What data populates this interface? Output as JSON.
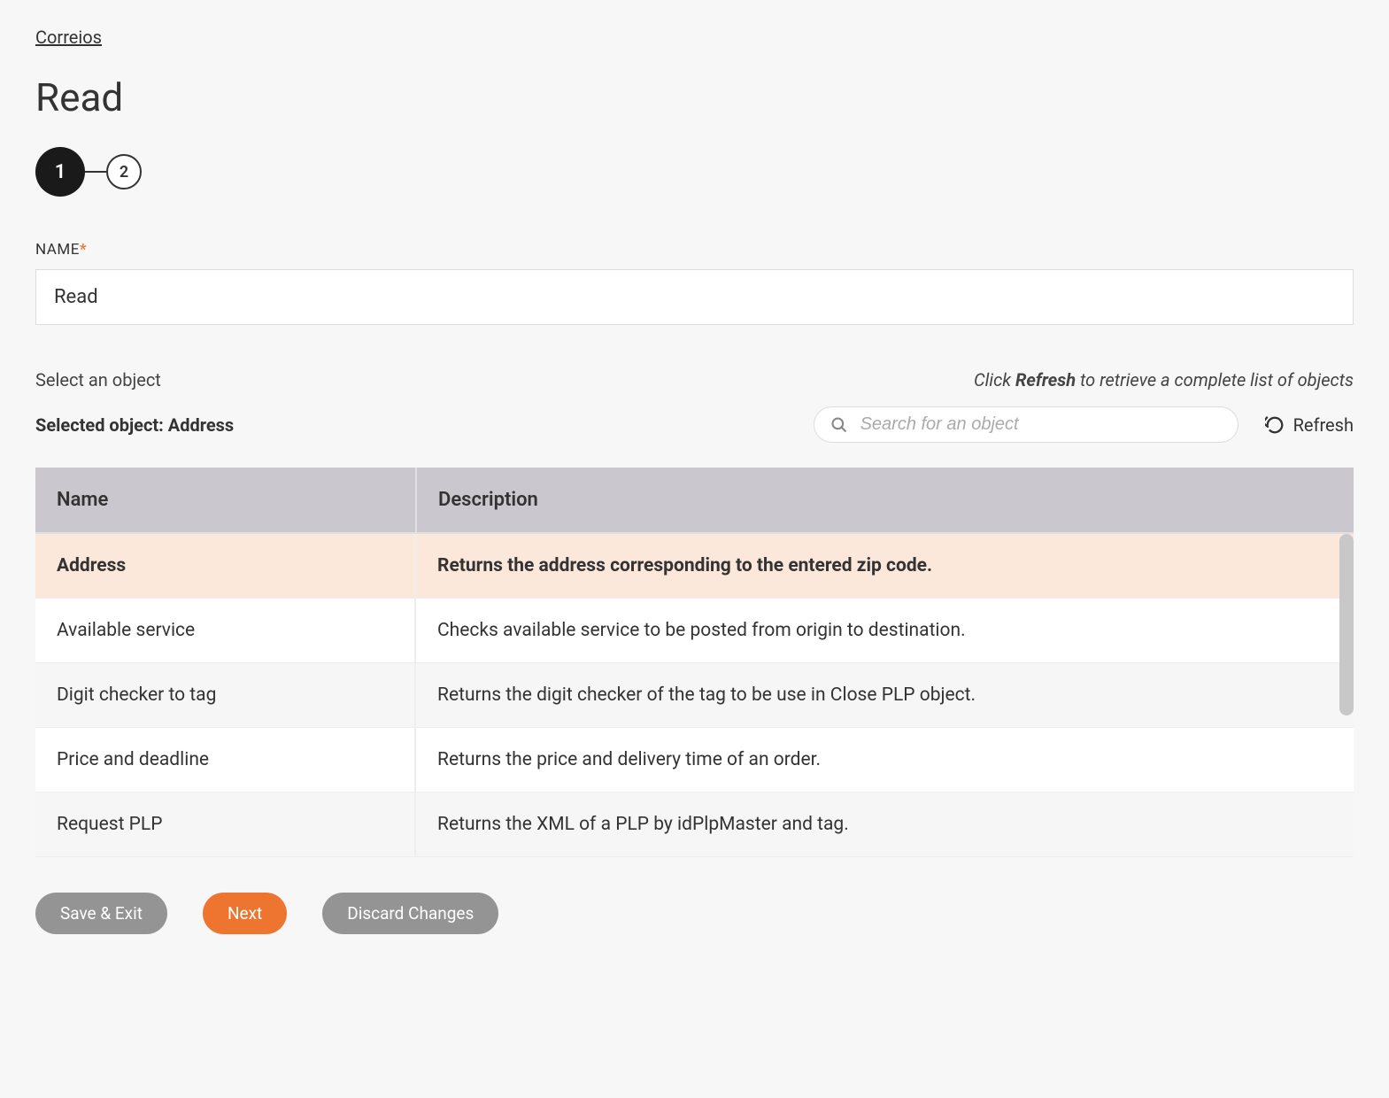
{
  "breadcrumb": {
    "label": "Correios"
  },
  "page": {
    "title": "Read"
  },
  "stepper": {
    "steps": [
      {
        "label": "1",
        "active": true
      },
      {
        "label": "2",
        "active": false
      }
    ]
  },
  "form": {
    "name_label": "NAME",
    "name_value": "Read"
  },
  "object_section": {
    "select_label": "Select an object",
    "hint_prefix": "Click ",
    "hint_bold": "Refresh",
    "hint_suffix": " to retrieve a complete list of objects",
    "selected_label": "Selected object: Address",
    "search_placeholder": "Search for an object",
    "refresh_label": "Refresh"
  },
  "table": {
    "headers": {
      "name": "Name",
      "description": "Description"
    },
    "rows": [
      {
        "name": "Address",
        "description": "Returns the address corresponding to the entered zip code.",
        "selected": true
      },
      {
        "name": "Available service",
        "description": "Checks available service to be posted from origin to destination.",
        "selected": false
      },
      {
        "name": "Digit checker to tag",
        "description": "Returns the digit checker of the tag to be use in Close PLP object.",
        "selected": false
      },
      {
        "name": "Price and deadline",
        "description": "Returns the price and delivery time of an order.",
        "selected": false
      },
      {
        "name": "Request PLP",
        "description": "Returns the XML of a PLP by idPlpMaster and tag.",
        "selected": false
      }
    ]
  },
  "footer": {
    "save_exit": "Save & Exit",
    "next": "Next",
    "discard": "Discard Changes"
  }
}
